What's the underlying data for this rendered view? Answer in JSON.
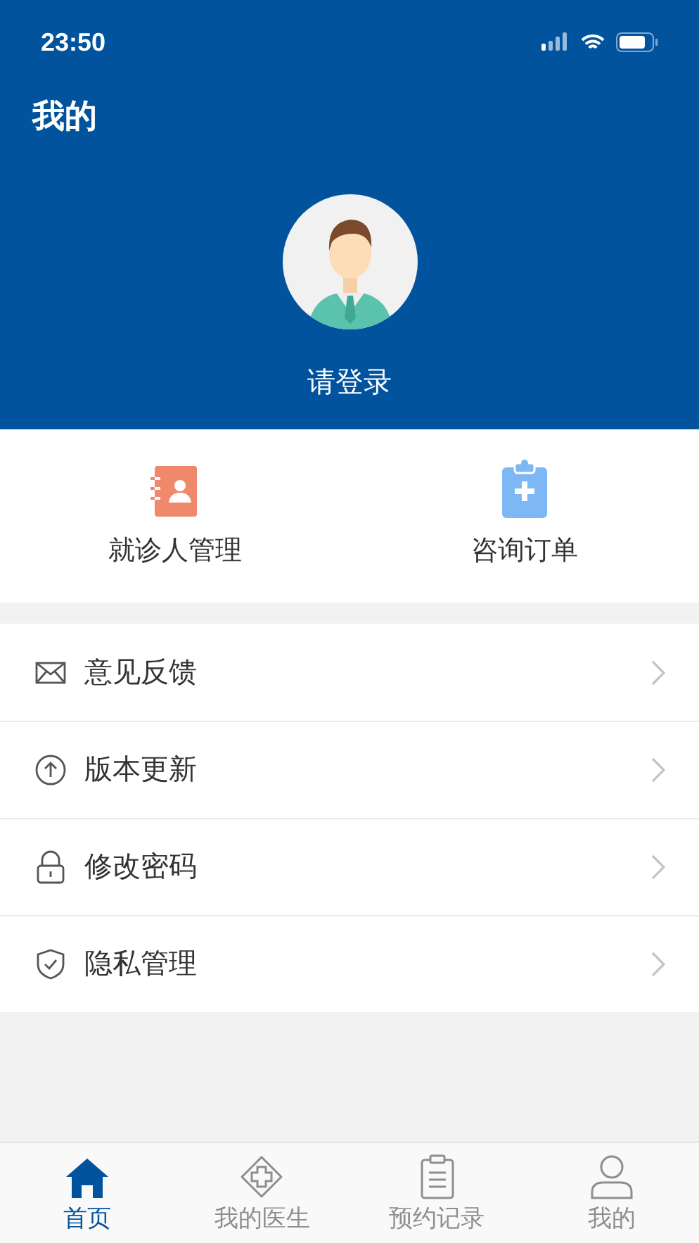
{
  "status_bar": {
    "time": "23:50"
  },
  "header": {
    "title": "我的",
    "login_label": "请登录"
  },
  "quick_actions": [
    {
      "label": "就诊人管理"
    },
    {
      "label": "咨询订单"
    }
  ],
  "menu": [
    {
      "label": "意见反馈"
    },
    {
      "label": "版本更新"
    },
    {
      "label": "修改密码"
    },
    {
      "label": "隐私管理"
    }
  ],
  "tab_bar": [
    {
      "label": "首页",
      "selected": true
    },
    {
      "label": "我的医生",
      "selected": false
    },
    {
      "label": "预约记录",
      "selected": false
    },
    {
      "label": "我的",
      "selected": false
    }
  ]
}
